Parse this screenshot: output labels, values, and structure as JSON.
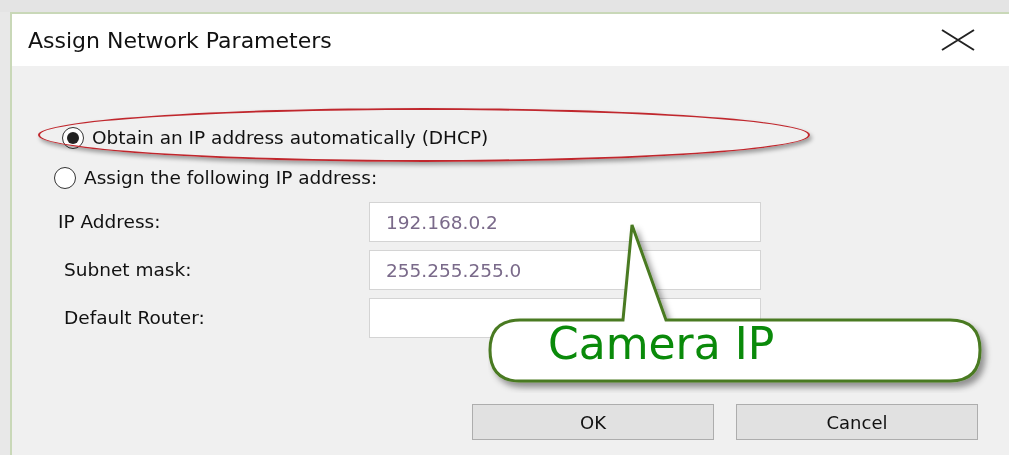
{
  "window": {
    "title": "Assign Network Parameters"
  },
  "options": [
    {
      "label": "Obtain an IP address automatically (DHCP)",
      "selected": true,
      "highlighted": true
    },
    {
      "label": "Assign the following IP address:",
      "selected": false,
      "highlighted": false
    }
  ],
  "fields": [
    {
      "label": "IP Address:",
      "value": "192.168.0.2"
    },
    {
      "label": "Subnet mask:",
      "value": "255.255.255.0"
    },
    {
      "label": "Default Router:"
    }
  ],
  "callout": {
    "text": "Camera IP"
  },
  "buttons": [
    "OK",
    "Cancel"
  ]
}
